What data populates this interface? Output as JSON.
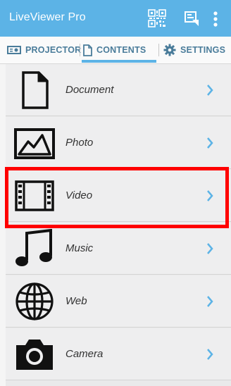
{
  "app": {
    "title": "LiveViewer Pro"
  },
  "header_icons": [
    "qr-code-icon",
    "cast-icon",
    "more-vert-icon"
  ],
  "tabs": [
    {
      "label": "PROJECTOR",
      "icon": "projector-icon"
    },
    {
      "label": "CONTENTS",
      "icon": "document-icon",
      "selected": true
    },
    {
      "label": "SETTINGS",
      "icon": "gear-icon"
    }
  ],
  "items": [
    {
      "label": "Document",
      "icon": "document-icon"
    },
    {
      "label": "Photo",
      "icon": "photo-icon"
    },
    {
      "label": "Video",
      "icon": "film-icon"
    },
    {
      "label": "Music",
      "icon": "music-note-icon"
    },
    {
      "label": "Web",
      "icon": "globe-icon"
    },
    {
      "label": "Camera",
      "icon": "camera-icon"
    }
  ],
  "colors": {
    "accent": "#5cb3e6",
    "tab_text": "#4a7c9a",
    "highlight": "#ff0000"
  }
}
